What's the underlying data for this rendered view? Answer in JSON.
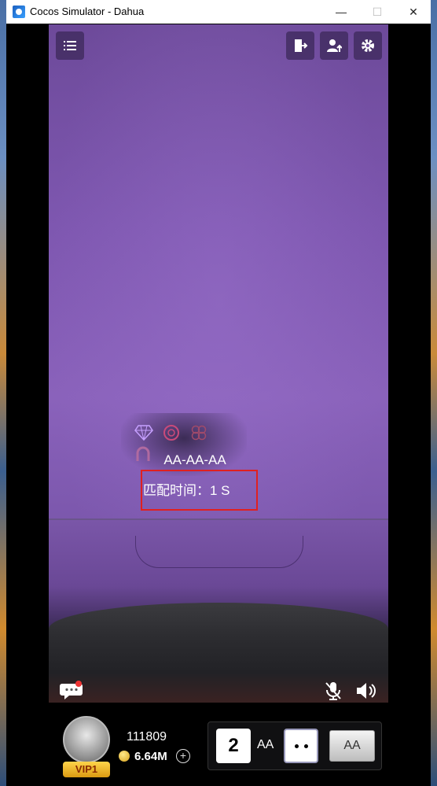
{
  "window": {
    "title": "Cocos Simulator - Dahua",
    "minimize": "—",
    "maximize": "☐",
    "close": "✕"
  },
  "toolbar": {
    "menu_icon": "menu-icon",
    "exit_icon": "exit-door-icon",
    "user_icon": "user-upload-icon",
    "settings_icon": "gear-icon"
  },
  "match": {
    "suit_icons": [
      "diamond-icon",
      "wheel-icon",
      "clover-icon",
      "horseshoe-icon"
    ],
    "code": "AA-AA-AA",
    "time_label": "匹配时间：1 S"
  },
  "controls": {
    "chat_icon": "chat-icon",
    "mic_icon": "mic-muted-icon",
    "speaker_icon": "speaker-icon"
  },
  "player": {
    "id": "111809",
    "vip": "VIP1",
    "coins": "6.64M",
    "add": "+"
  },
  "room": {
    "number": "2",
    "code": "AA",
    "button": "AA"
  },
  "colors": {
    "felt": "#7e57b0",
    "highlight_box": "#e02020"
  }
}
